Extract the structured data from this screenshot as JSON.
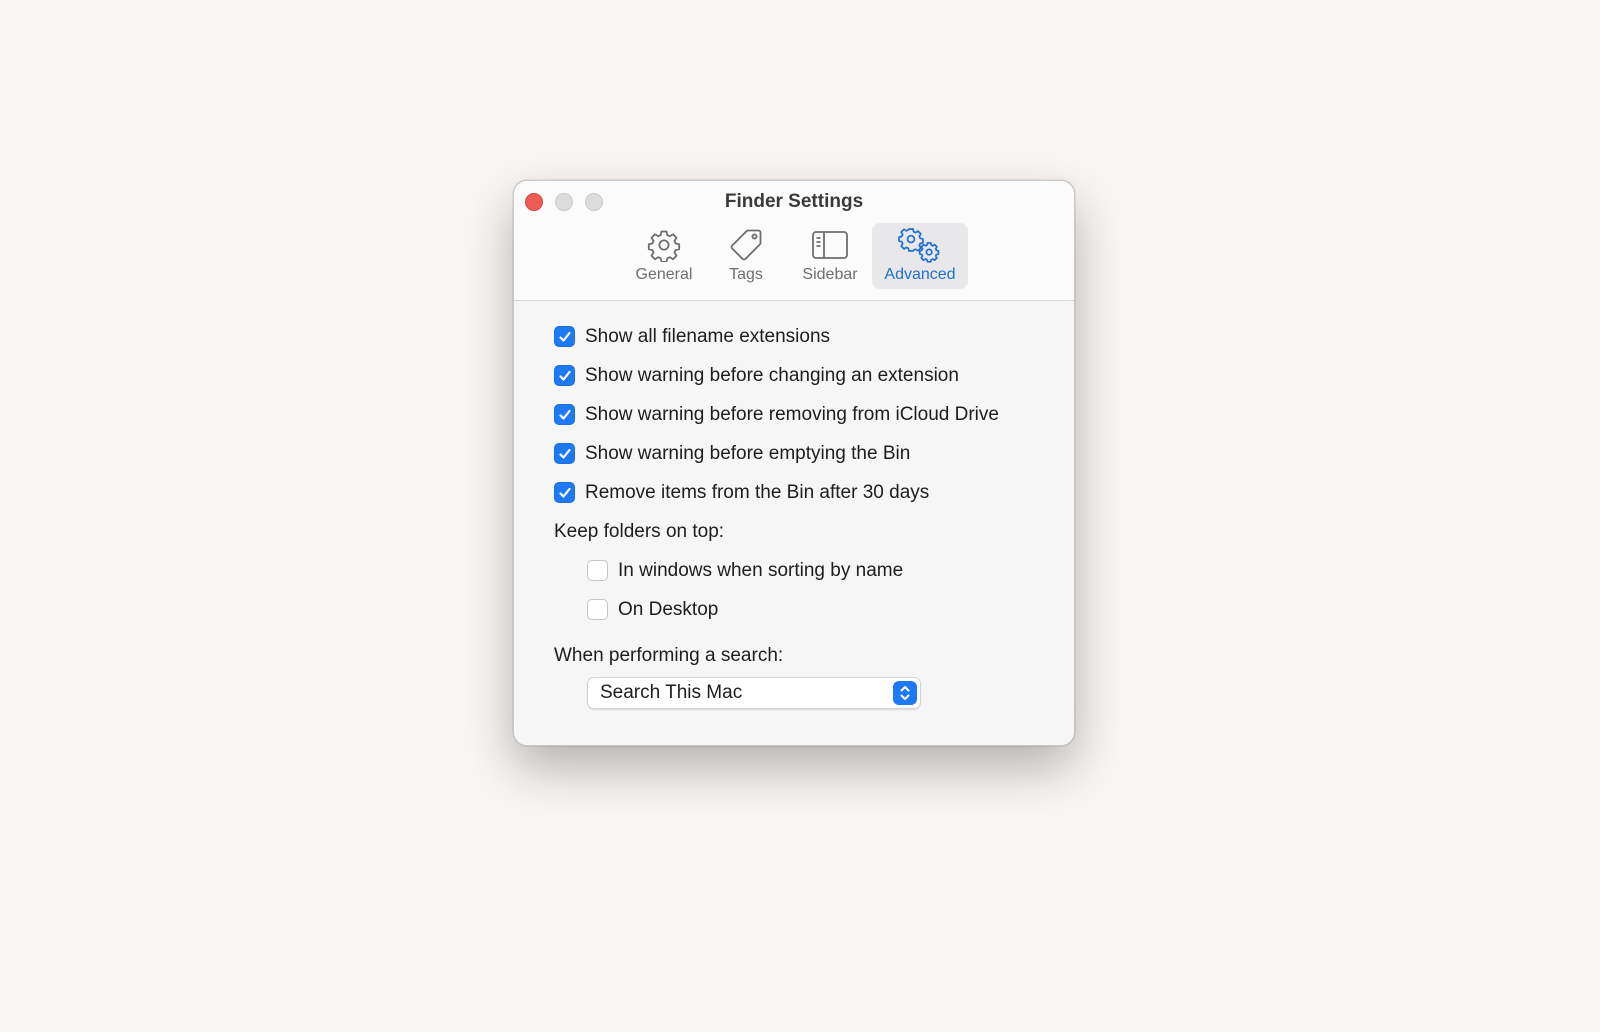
{
  "window": {
    "title": "Finder Settings"
  },
  "tabs": [
    {
      "label": "General",
      "icon": "gear-icon",
      "active": false
    },
    {
      "label": "Tags",
      "icon": "tag-icon",
      "active": false
    },
    {
      "label": "Sidebar",
      "icon": "sidebar-icon",
      "active": false
    },
    {
      "label": "Advanced",
      "icon": "gears-icon",
      "active": true
    }
  ],
  "options": [
    {
      "label": "Show all filename extensions",
      "checked": true
    },
    {
      "label": "Show warning before changing an extension",
      "checked": true
    },
    {
      "label": "Show warning before removing from iCloud Drive",
      "checked": true
    },
    {
      "label": "Show warning before emptying the Bin",
      "checked": true
    },
    {
      "label": "Remove items from the Bin after 30 days",
      "checked": true
    }
  ],
  "folders_on_top": {
    "label": "Keep folders on top:",
    "items": [
      {
        "label": "In windows when sorting by name",
        "checked": false
      },
      {
        "label": "On Desktop",
        "checked": false
      }
    ]
  },
  "search": {
    "label": "When performing a search:",
    "selected": "Search This Mac"
  },
  "colors": {
    "accent": "#1d7af3",
    "close": "#ee5b54"
  }
}
